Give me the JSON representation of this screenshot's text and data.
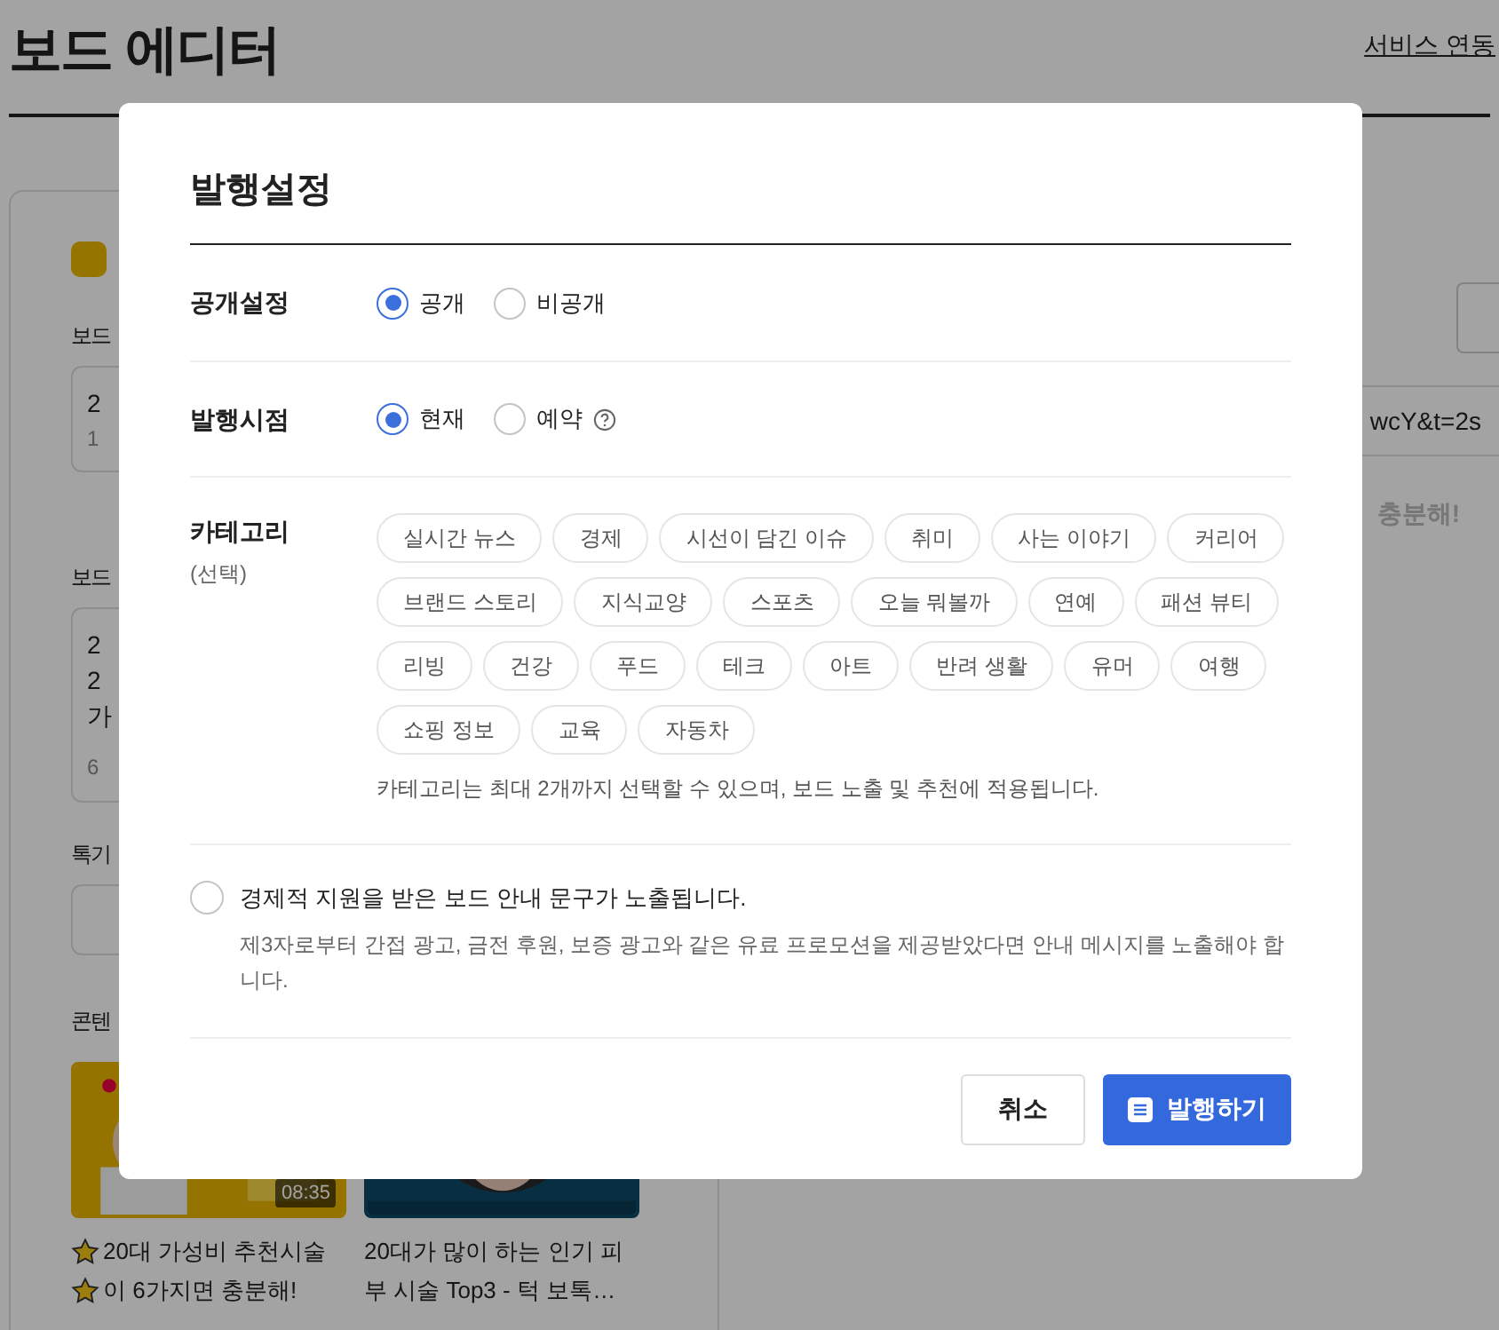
{
  "page": {
    "title": "보드 에디터",
    "link": "서비스 연동"
  },
  "left_panel": {
    "title_label": "보드",
    "title_field": {
      "value": "2",
      "count": "1"
    },
    "desc_label": "보드",
    "desc_field": {
      "lines": [
        "2",
        "2",
        "가"
      ],
      "count": "6"
    },
    "tag_label": "톡기",
    "content_label": "콘텐",
    "cards": [
      {
        "starred": true,
        "title_lines": [
          "20대 가성비 추천시술",
          "이 6가지면 충분해!"
        ],
        "duration": "08:35"
      },
      {
        "starred": false,
        "title_lines": [
          "20대가 많이 하는 인기 피",
          "부 시술 Top3 - 턱 보톡…"
        ]
      }
    ]
  },
  "right_panel": {
    "url_tail": "wcY&t=2s",
    "preview_text": "충분해!"
  },
  "dialog": {
    "title": "발행설정",
    "visibility": {
      "label": "공개설정",
      "options": [
        {
          "label": "공개",
          "selected": true
        },
        {
          "label": "비공개",
          "selected": false
        }
      ]
    },
    "timing": {
      "label": "발행시점",
      "options": [
        {
          "label": "현재",
          "selected": true,
          "help": false
        },
        {
          "label": "예약",
          "selected": false,
          "help": true
        }
      ]
    },
    "category": {
      "label": "카테고리",
      "sublabel": "(선택)",
      "hint": "카테고리는 최대 2개까지 선택할 수 있으며, 보드 노출 및 추천에 적용됩니다.",
      "items": [
        {
          "label": "실시간 뉴스",
          "selected": false
        },
        {
          "label": "경제",
          "selected": false
        },
        {
          "label": "시선이 담긴 이슈",
          "selected": false
        },
        {
          "label": "취미",
          "selected": false
        },
        {
          "label": "사는 이야기",
          "selected": false
        },
        {
          "label": "커리어",
          "selected": false
        },
        {
          "label": "브랜드 스토리",
          "selected": false
        },
        {
          "label": "지식교양",
          "selected": false
        },
        {
          "label": "스포츠",
          "selected": false
        },
        {
          "label": "오늘 뭐볼까",
          "selected": false
        },
        {
          "label": "연예",
          "selected": false
        },
        {
          "label": "패션 뷰티",
          "selected": false
        },
        {
          "label": "리빙",
          "selected": false
        },
        {
          "label": "건강",
          "selected": false
        },
        {
          "label": "푸드",
          "selected": false
        },
        {
          "label": "테크",
          "selected": false
        },
        {
          "label": "아트",
          "selected": false
        },
        {
          "label": "반려 생활",
          "selected": false
        },
        {
          "label": "유머",
          "selected": false
        },
        {
          "label": "여행",
          "selected": false
        },
        {
          "label": "쇼핑 정보",
          "selected": false
        },
        {
          "label": "교육",
          "selected": false
        },
        {
          "label": "자동차",
          "selected": false
        }
      ]
    },
    "sponsorship": {
      "checked": false,
      "label": "경제적 지원을 받은 보드 안내 문구가 노출됩니다.",
      "description": "제3자로부터 간접 광고, 금전 후원, 보증 광고와 같은 유료 프로모션을 제공받았다면 안내 메시지를 노출해야 합니다."
    },
    "buttons": {
      "cancel": "취소",
      "publish": "발행하기"
    }
  }
}
